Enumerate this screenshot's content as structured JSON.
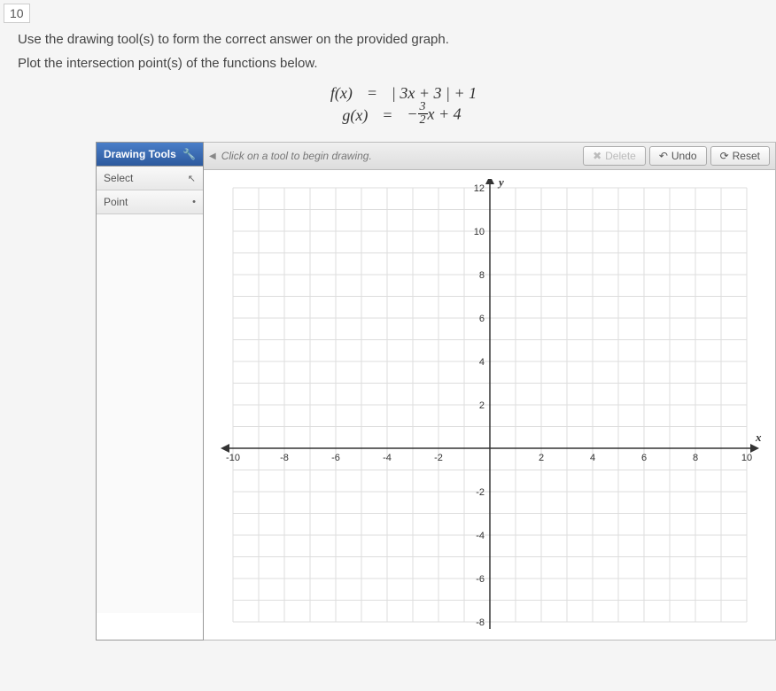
{
  "question_number": "10",
  "instruction_main": "Use the drawing tool(s) to form the correct answer on the provided graph.",
  "instruction_sub": "Plot the intersection point(s) of the functions below.",
  "equations": {
    "f_lhs": "f(x)",
    "f_eq": "=",
    "f_rhs": "| 3x + 3 |  + 1",
    "g_lhs": "g(x)",
    "g_eq": "=",
    "g_frac_num": "3",
    "g_frac_den": "2",
    "g_rhs_tail": "x + 4"
  },
  "tools": {
    "header": "Drawing Tools",
    "select": "Select",
    "point": "Point"
  },
  "hint": "Click on a tool to begin drawing.",
  "buttons": {
    "delete": "Delete",
    "undo": "Undo",
    "reset": "Reset"
  },
  "chart_data": {
    "type": "scatter",
    "title": "",
    "xlabel": "x",
    "ylabel": "y",
    "xlim": [
      -10,
      10
    ],
    "ylim": [
      -8,
      12
    ],
    "x_ticks": [
      -10,
      -8,
      -6,
      -4,
      -2,
      2,
      4,
      6,
      8,
      10
    ],
    "y_ticks": [
      -8,
      -6,
      -4,
      -2,
      2,
      4,
      6,
      8,
      10,
      12
    ],
    "grid": true,
    "series": []
  }
}
